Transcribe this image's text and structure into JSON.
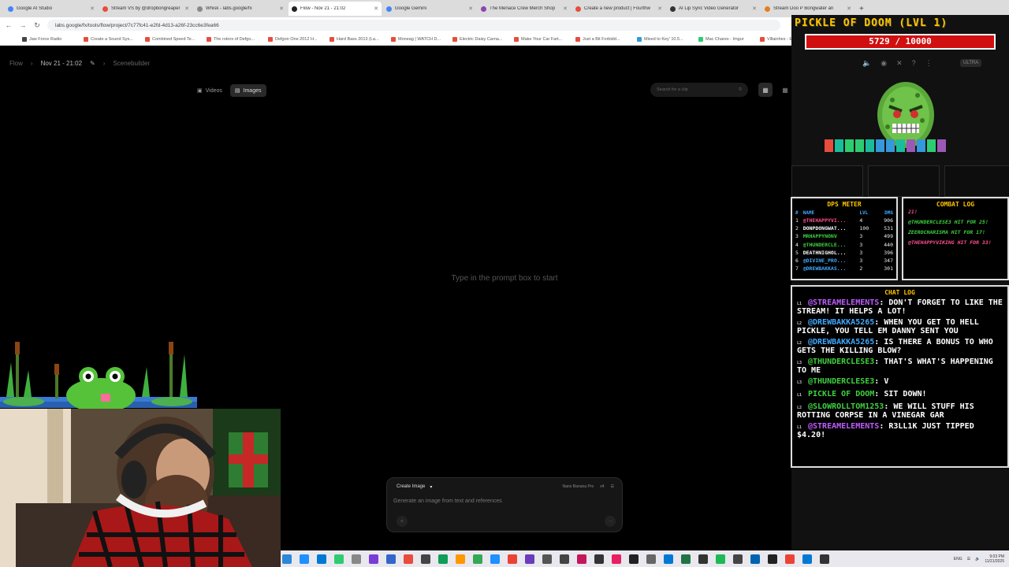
{
  "browser": {
    "tabs": [
      {
        "title": "Google AI Studio",
        "color": "#4285f4",
        "active": false
      },
      {
        "title": "Stream VS by @dropbongreaper",
        "color": "#e74c3c",
        "active": false
      },
      {
        "title": "Whisk - labs.google/fx",
        "color": "#888888",
        "active": false
      },
      {
        "title": "Flow - Nov 21 - 21:02",
        "color": "#222222",
        "active": true
      },
      {
        "title": "Google Gemini",
        "color": "#4285f4",
        "active": false
      },
      {
        "title": "The Menace Crew Merch Shop",
        "color": "#8e44ad",
        "active": false
      },
      {
        "title": "Create a new product | Fourthw",
        "color": "#e74c3c",
        "active": false
      },
      {
        "title": "AI Lip Sync Video Generator",
        "color": "#333333",
        "active": false
      },
      {
        "title": "Stream Doo P Bongwater an",
        "color": "#e67e22",
        "active": false
      }
    ],
    "url": "labs.google/fx/tools/flow/project/7c77fc41-e2fd-4d13-a26f-23cc6e3fea66",
    "bookmarks": [
      {
        "label": "Jaw Force Radio",
        "color": "#444444"
      },
      {
        "label": "Create a Sound Sys...",
        "color": "#e74c3c"
      },
      {
        "label": "Combined Speed Te...",
        "color": "#e74c3c"
      },
      {
        "label": "The rotors of Defgo...",
        "color": "#e74c3c"
      },
      {
        "label": "Defgon One 2012 H...",
        "color": "#e74c3c"
      },
      {
        "label": "Hard Bass 2013 (La...",
        "color": "#e74c3c"
      },
      {
        "label": "Moneag | WATCH D...",
        "color": "#e74c3c"
      },
      {
        "label": "Electric Daisy Carna...",
        "color": "#e74c3c"
      },
      {
        "label": "Make Your Car Fart...",
        "color": "#e74c3c"
      },
      {
        "label": "Just a Bit Forbidd...",
        "color": "#e74c3c"
      },
      {
        "label": "Mixed to Key' 10.5...",
        "color": "#3498db"
      },
      {
        "label": "Mac Chares - Imgur",
        "color": "#2ecc71"
      },
      {
        "label": "Villainhes - Echoes...",
        "color": "#e74c3c"
      }
    ]
  },
  "app": {
    "breadcrumb": {
      "root": "Flow",
      "project": "Nov 21 - 21:02",
      "scene": "Scenebuilder"
    },
    "media_tabs": [
      {
        "label": "Videos",
        "selected": false
      },
      {
        "label": "Images",
        "selected": true
      }
    ],
    "search_placeholder": "Search for a clip",
    "empty_hint": "Type in the prompt box to start",
    "prompt": {
      "mode": "Create Image",
      "model": "Nano Banana Pro",
      "count": "x4",
      "placeholder": "Generate an image from text and references"
    }
  },
  "game": {
    "title": "PICKLE OF DOOM (LVL 1)",
    "hp": "5729 / 10000",
    "hp_fraction": 0.573,
    "ultra_label": "ULTRA",
    "dps_meter": {
      "title": "DPS METER",
      "headers": [
        "#",
        "NAME",
        "LVL",
        "DMG"
      ],
      "rows": [
        {
          "rank": "1",
          "name": "@THEHAPPYVI...",
          "lvl": "4",
          "dmg": "906",
          "color": "#ff4d8d"
        },
        {
          "rank": "2",
          "name": "DONPDONGWAT...",
          "lvl": "100",
          "dmg": "531",
          "color": "#ffffff"
        },
        {
          "rank": "3",
          "name": "MRHAPPYNONV",
          "lvl": "3",
          "dmg": "499",
          "color": "#3fd13f"
        },
        {
          "rank": "4",
          "name": "@THUNDERCLE...",
          "lvl": "3",
          "dmg": "440",
          "color": "#3fd13f"
        },
        {
          "rank": "5",
          "name": "DEATHNIGHOL...",
          "lvl": "3",
          "dmg": "396",
          "color": "#ffffff"
        },
        {
          "rank": "6",
          "name": "@DIVINE_PRO...",
          "lvl": "3",
          "dmg": "347",
          "color": "#3fa9ff"
        },
        {
          "rank": "7",
          "name": "@DREWBAKKAS...",
          "lvl": "2",
          "dmg": "301",
          "color": "#3fa9ff"
        }
      ]
    },
    "combat_log": {
      "title": "COMBAT LOG",
      "entries": [
        {
          "text": "21!",
          "color": "#ff4d8d"
        },
        {
          "text": "@THUNDERCLESE3 HIT FOR 25!",
          "color": "#3fd13f"
        },
        {
          "text": "ZEEROCHARISMA HIT FOR 17!",
          "color": "#3fd13f"
        },
        {
          "text": "@THEHAPPYVIKING HIT FOR 33!",
          "color": "#ff4d8d"
        }
      ]
    },
    "chat_log": {
      "title": "CHAT LOG",
      "messages": [
        {
          "lvl": "L1",
          "user": "@STREAMELEMENTS",
          "text": ": DON'T FORGET TO LIKE THE STREAM! IT HELPS A LOT!",
          "color": "#c05cff"
        },
        {
          "lvl": "L2",
          "user": "@DREWBAKKA5265",
          "text": ": WHEN YOU GET TO HELL PICKLE, YOU TELL EM DANNY SENT YOU",
          "color": "#3fa9ff"
        },
        {
          "lvl": "L2",
          "user": "@DREWBAKKA5265",
          "text": ": IS THERE A BONUS TO WHO GETS THE KILLING BLOW?",
          "color": "#3fa9ff"
        },
        {
          "lvl": "L3",
          "user": "@THUNDERCLESE3",
          "text": ": THAT'S WHAT'S HAPPENING TO ME",
          "color": "#3fd13f"
        },
        {
          "lvl": "L3",
          "user": "@THUNDERCLESE3",
          "text": ": V",
          "color": "#3fd13f"
        },
        {
          "lvl": "L1",
          "user": "PICKLE OF DOOM",
          "text": ": SIT DOWN!",
          "color": "#3fd13f"
        },
        {
          "lvl": "L2",
          "user": "@SLOWROLLTOM1253",
          "text": ": WE WILL STUFF HIS ROTTING CORPSE IN A VINEGAR GAR",
          "color": "#3fd13f"
        },
        {
          "lvl": "L1",
          "user": "@STREAMELEMENTS",
          "text": ": R3LL1K JUST TIPPED $4.20!",
          "color": "#c05cff"
        }
      ]
    },
    "runes": [
      "#e74c3c",
      "#1abc9c",
      "#2ecc71",
      "#2ecc71",
      "#1abc9c",
      "#3498db",
      "#3498db",
      "#1abc9c",
      "#9b59b6",
      "#3498db",
      "#2ecc71",
      "#9b59b6"
    ]
  },
  "taskbar": {
    "icons": [
      "#2b88d8",
      "#1e90ff",
      "#0078d4",
      "#2ecc71",
      "#888888",
      "#7a3cd6",
      "#3366cc",
      "#e74c3c",
      "#444444",
      "#0f9d58",
      "#ff9800",
      "#34a853",
      "#1e90ff",
      "#ea4335",
      "#6a3cbc",
      "#555555",
      "#444444",
      "#c2185b",
      "#333333",
      "#e91e63",
      "#222222",
      "#666666",
      "#0078d4",
      "#217346",
      "#333333",
      "#1db954",
      "#444444",
      "#0063b1",
      "#222222",
      "#ea4335",
      "#0078d4",
      "#333333"
    ],
    "lang": "ENG",
    "time": "9:03 PM",
    "date": "11/21/2025"
  }
}
